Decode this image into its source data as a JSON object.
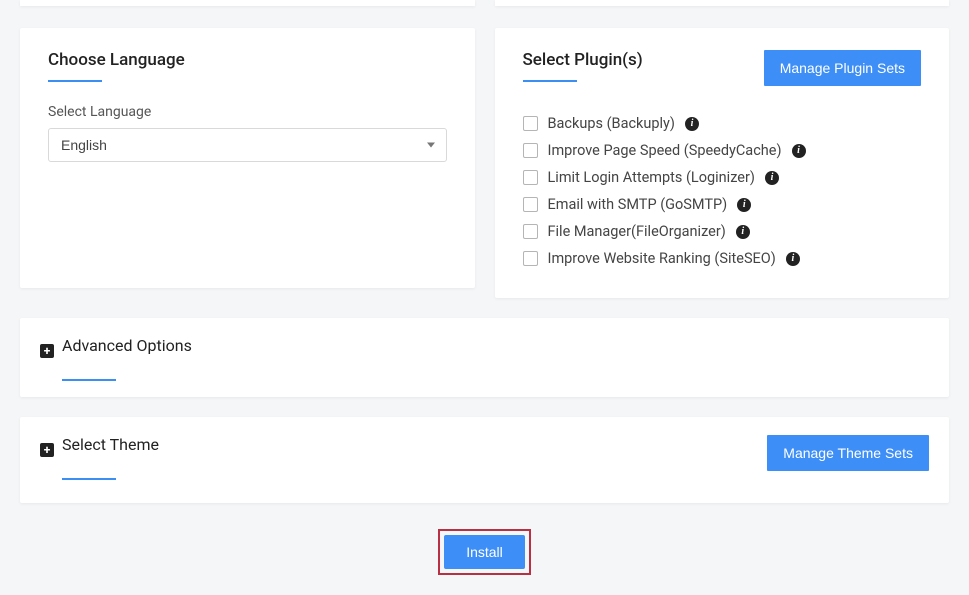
{
  "language": {
    "title": "Choose Language",
    "field_label": "Select Language",
    "selected": "English"
  },
  "plugins": {
    "title": "Select Plugin(s)",
    "manage_button": "Manage Plugin Sets",
    "items": [
      {
        "label": "Backups (Backuply)"
      },
      {
        "label": "Improve Page Speed (SpeedyCache)"
      },
      {
        "label": "Limit Login Attempts (Loginizer)"
      },
      {
        "label": "Email with SMTP (GoSMTP)"
      },
      {
        "label": "File Manager(FileOrganizer)"
      },
      {
        "label": "Improve Website Ranking (SiteSEO)"
      }
    ]
  },
  "advanced": {
    "title": "Advanced Options"
  },
  "theme": {
    "title": "Select Theme",
    "manage_button": "Manage Theme Sets"
  },
  "install_button": "Install"
}
